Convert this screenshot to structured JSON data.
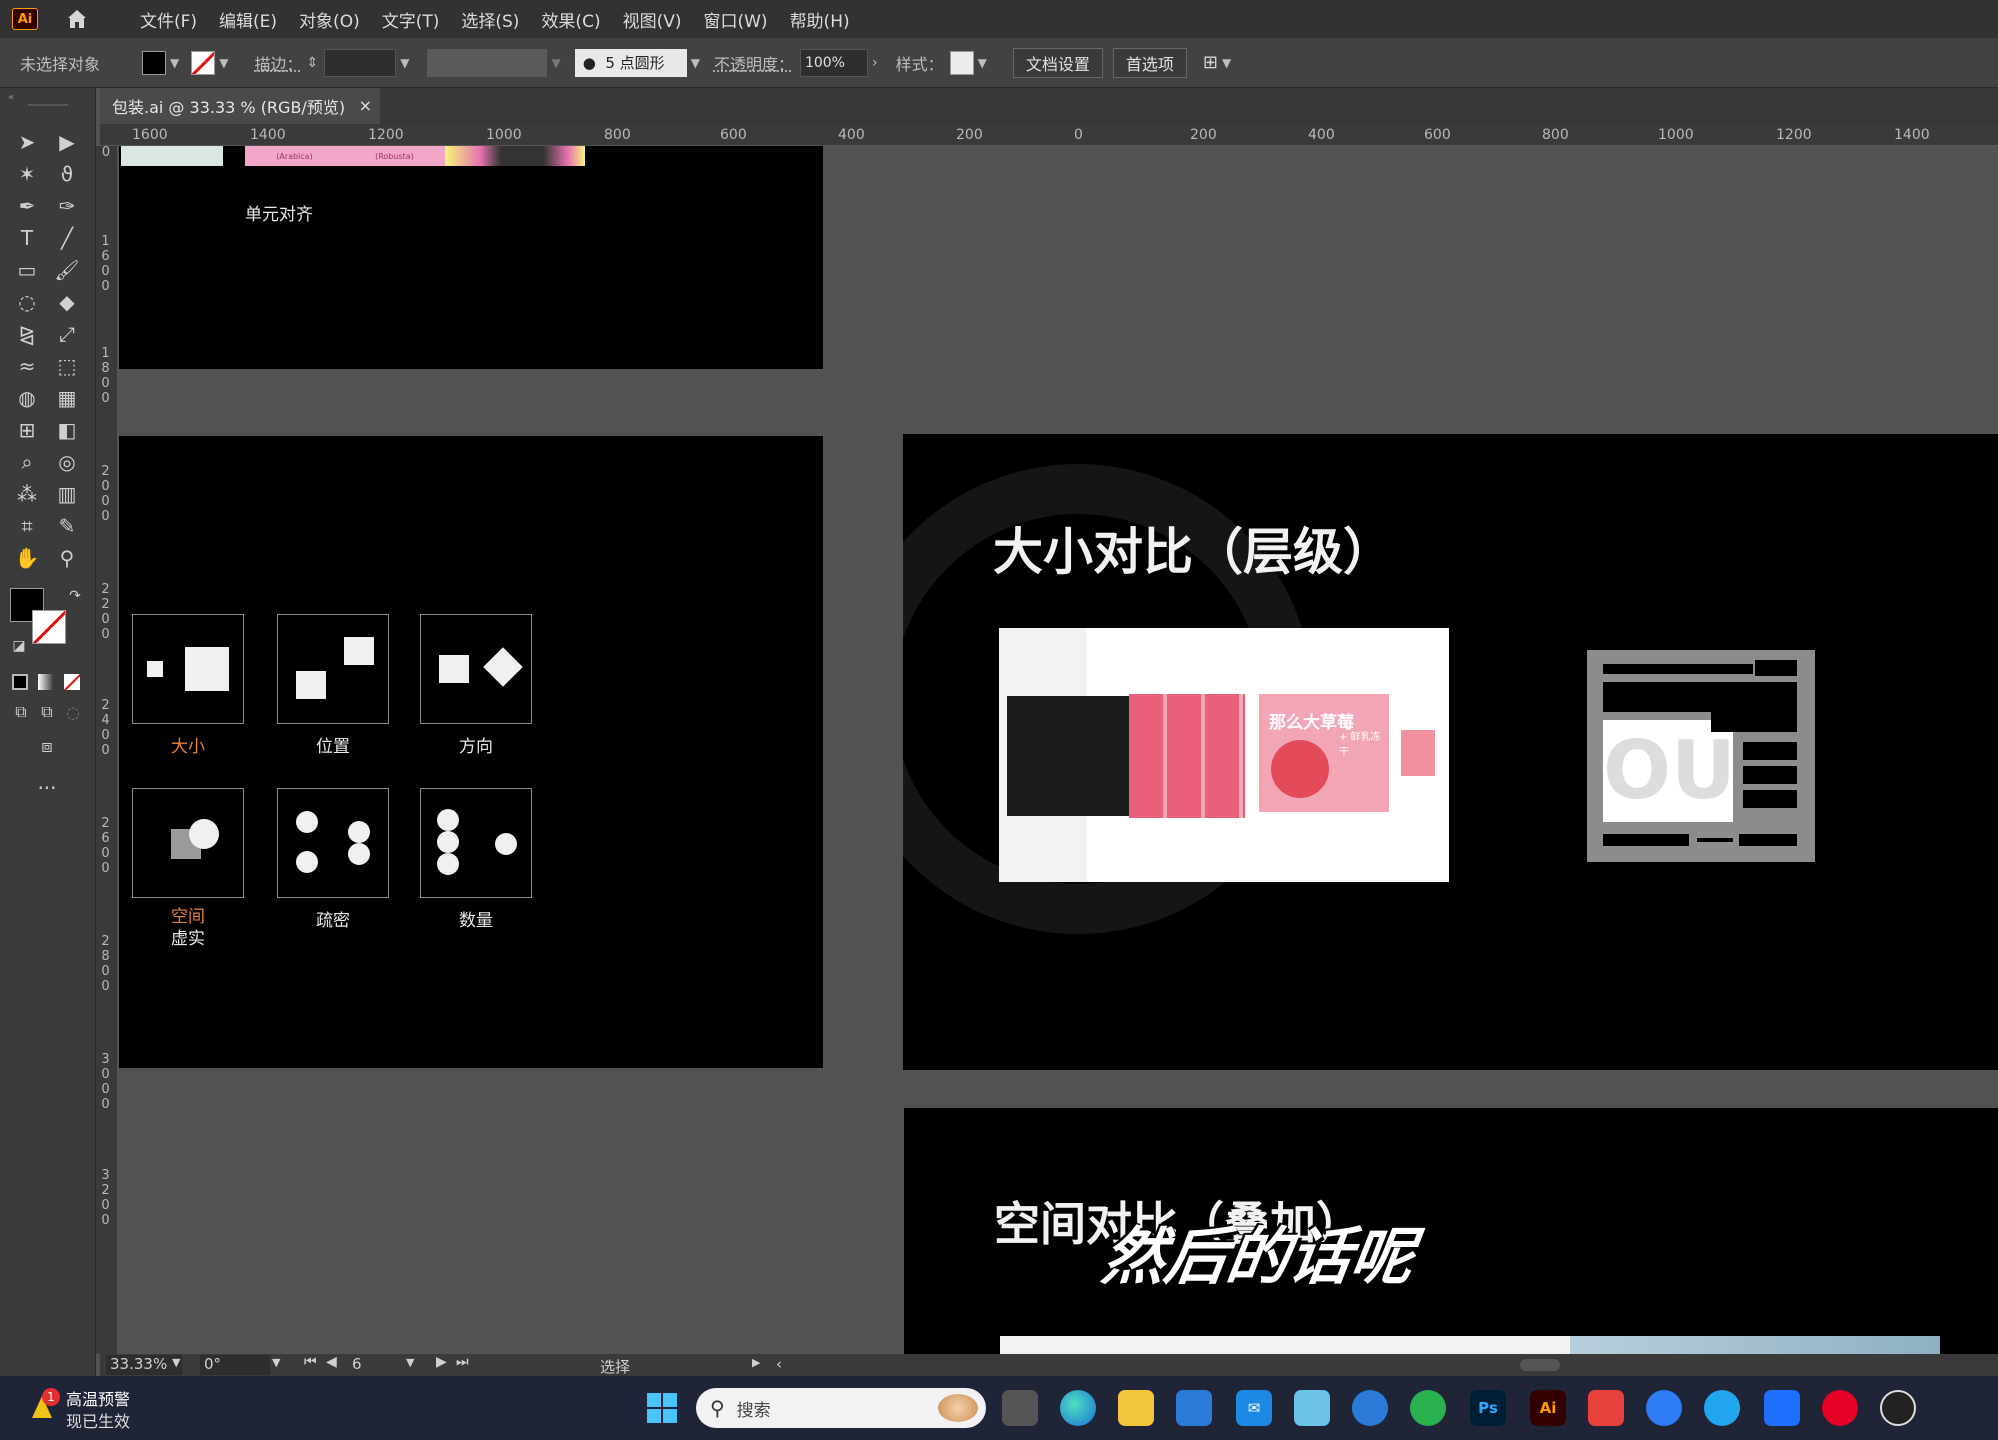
{
  "app": {
    "logo": "Ai",
    "home_icon": "home-icon"
  },
  "menu": [
    "文件(F)",
    "编辑(E)",
    "对象(O)",
    "文字(T)",
    "选择(S)",
    "效果(C)",
    "视图(V)",
    "窗口(W)",
    "帮助(H)"
  ],
  "control": {
    "selection_status": "未选择对象",
    "stroke_label": "描边：",
    "brush_label": "5 点圆形",
    "opacity_label": "不透明度：",
    "opacity_value": "100%",
    "style_label": "样式：",
    "doc_settings": "文档设置",
    "preferences": "首选项"
  },
  "tab": {
    "title": "包装.ai @ 33.33 % (RGB/预览)",
    "close": "×"
  },
  "ruler_h": [
    "1600",
    "1400",
    "1200",
    "1000",
    "800",
    "600",
    "400",
    "200",
    "0",
    "200",
    "400",
    "600",
    "800",
    "1000",
    "1200",
    "1400"
  ],
  "ruler_v": [
    "0",
    "1600",
    "1800",
    "2000",
    "2200",
    "2400",
    "2600",
    "2800",
    "3000",
    "3200"
  ],
  "artboard1": {
    "text": "单元对齐",
    "strip_text_1": "(Arabica)",
    "strip_text_2": "(Robusta)"
  },
  "artboard2": {
    "labels": [
      "大小",
      "位置",
      "方向",
      "空间",
      "疏密",
      "数量"
    ],
    "label_extra": "虚实",
    "accent_color": "#e8823a"
  },
  "artboard3": {
    "title": "大小对比（层级）",
    "product_title": "那么大草莓",
    "product_sub": "+ 鲜乳冻干",
    "wireframe_bg_text": "OU"
  },
  "artboard4": {
    "title": "空间对比（叠加）",
    "subtitle_overlay": "然后的话呢"
  },
  "status": {
    "zoom": "33.33%",
    "rotation": "0°",
    "page": "6",
    "tool": "选择"
  },
  "taskbar": {
    "weather_title": "高温预警",
    "weather_sub": "现已生效",
    "weather_badge": "1",
    "search_placeholder": "搜索",
    "apps": [
      "windows-icon",
      "task-view-icon",
      "edge-icon",
      "explorer-icon",
      "store-icon",
      "mail-icon",
      "photos-icon",
      "browser-icon",
      "wechat-icon",
      "photoshop-icon",
      "illustrator-icon",
      "app-red-icon",
      "app-blue-icon",
      "app-cyan-icon",
      "app-feishu-icon",
      "netease-music-icon",
      "obs-icon"
    ],
    "ps_label": "Ps",
    "ai_label": "Ai"
  }
}
